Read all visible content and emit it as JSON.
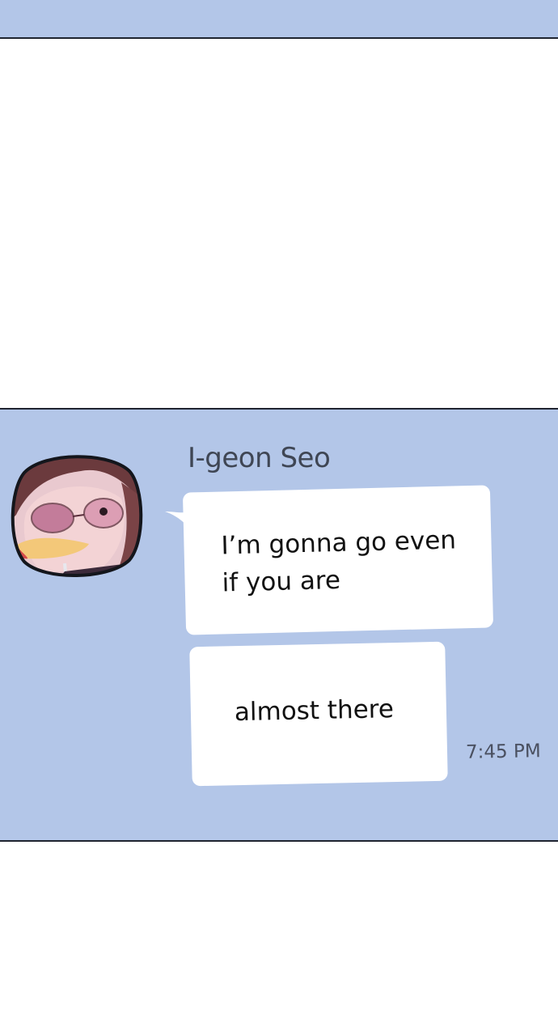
{
  "chat": {
    "sender_name": "I-geon Seo",
    "avatar_icon": "profile-avatar",
    "messages": [
      {
        "text_line1": "I’m gonna go even",
        "text_line2": "if you are"
      },
      {
        "text": "almost there"
      }
    ],
    "timestamp": "7:45 PM"
  },
  "colors": {
    "panel_bg": "#b3c6e8",
    "bubble_bg": "#ffffff",
    "border": "#1f2430"
  }
}
